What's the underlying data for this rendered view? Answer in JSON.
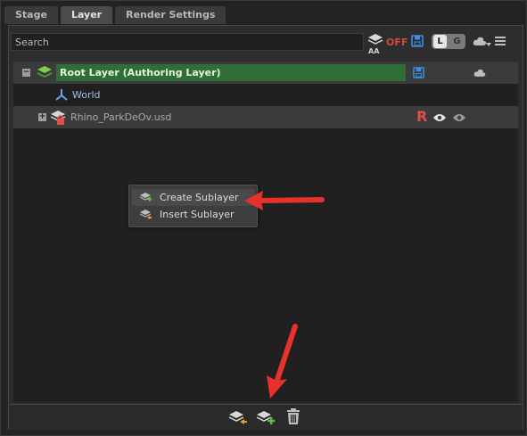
{
  "tabs": [
    {
      "label": "Stage"
    },
    {
      "label": "Layer"
    },
    {
      "label": "Render Settings"
    }
  ],
  "active_tab": "Layer",
  "toolbar": {
    "search_placeholder": "Search",
    "aa_label": "AA",
    "off_label": "OFF",
    "l_label": "L",
    "g_label": "G"
  },
  "tree": [
    {
      "label": "Root Layer (Authoring Layer)",
      "label_color": "#d8f0d0"
    },
    {
      "label": "World"
    },
    {
      "label": "Rhino_ParkDeOv.usd",
      "badge": "R"
    }
  ],
  "context_menu": {
    "items": [
      {
        "label": "Create Sublayer"
      },
      {
        "label": "Insert Sublayer"
      }
    ]
  },
  "colors": {
    "accent_green": "#2f6e36",
    "off_red": "#d24a3a",
    "annotation_red": "#e8312a",
    "save_blue": "#3a8ee6"
  },
  "icons": [
    "layers-icon",
    "save-icon",
    "cloud-icon",
    "menu-icon",
    "world-icon",
    "eye-icon",
    "lock-icon",
    "new-layer-icon",
    "insert-layer-icon",
    "delete-icon"
  ]
}
